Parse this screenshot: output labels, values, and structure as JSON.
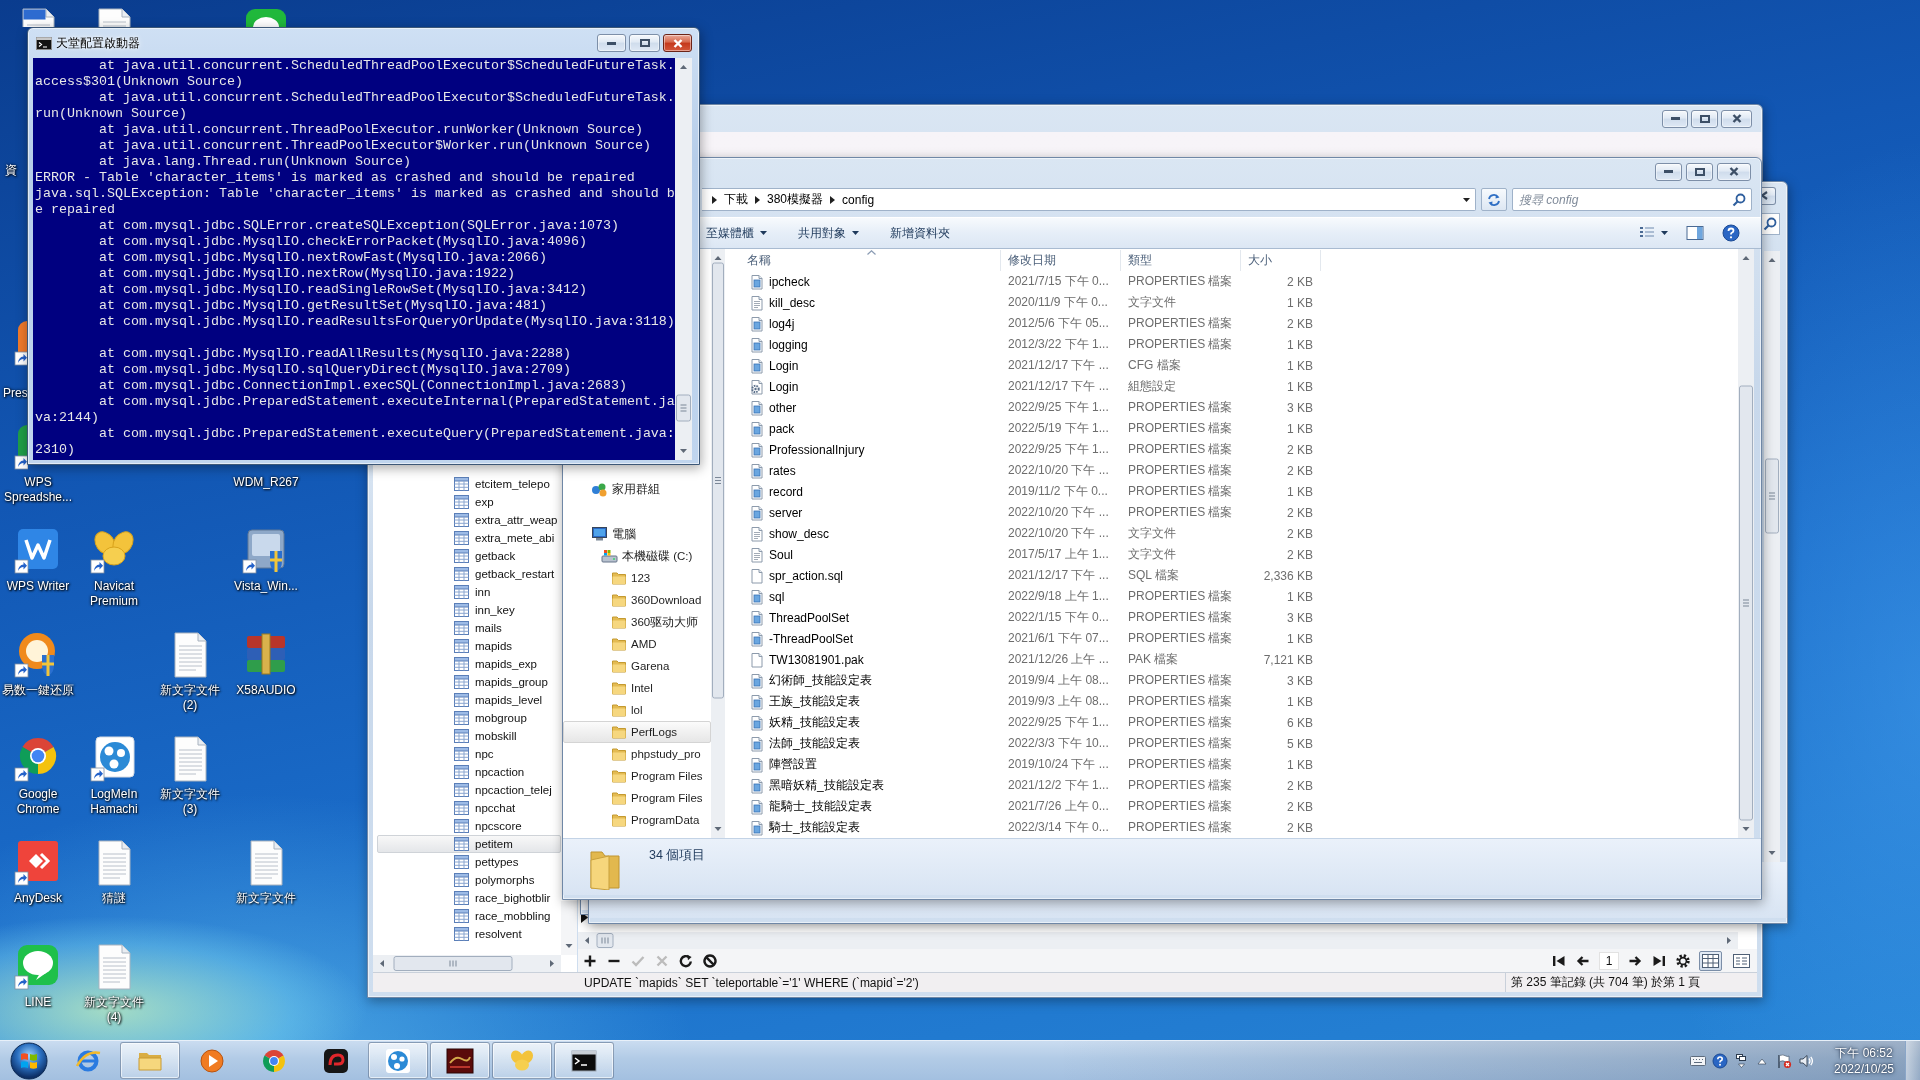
{
  "desktop": {
    "icons": [
      {
        "kind": "document"
      },
      {
        "kind": "text-file"
      },
      {
        "kind": "app"
      },
      {
        "kind": "label-only",
        "label": "資"
      },
      {
        "kind": "app",
        "label": "Pres"
      },
      {
        "kind": "app",
        "label": "WPS Spreadshe..."
      },
      {
        "kind": "label-only",
        "label": "WDM_R267"
      },
      {
        "kind": "app",
        "label": "WPS Writer"
      },
      {
        "kind": "app",
        "label": "Navicat Premium"
      },
      {
        "kind": "app",
        "label": "Vista_Win..."
      },
      {
        "kind": "app",
        "label": "易数一鍵还原"
      },
      {
        "kind": "text-file",
        "label": "新文字文件 (2)"
      },
      {
        "kind": "app",
        "label": "X58AUDIO"
      },
      {
        "kind": "app",
        "label": "Google Chrome"
      },
      {
        "kind": "app",
        "label": "LogMeIn Hamachi"
      },
      {
        "kind": "text-file",
        "label": "新文字文件 (3)"
      },
      {
        "kind": "app",
        "label": "AnyDesk"
      },
      {
        "kind": "text-file",
        "label": "猜謎"
      },
      {
        "kind": "text-file",
        "label": "新文字文件"
      },
      {
        "kind": "app",
        "label": "LINE"
      },
      {
        "kind": "text-file",
        "label": "新文字文件 (4)"
      }
    ]
  },
  "console": {
    "title": "天堂配置啟動器",
    "lines": [
      {
        "kind": "frame",
        "text": "at java.util.concurrent.ScheduledThreadPoolExecutor$ScheduledFutureTask."
      },
      {
        "kind": "message",
        "text": "access$301(Unknown Source)"
      },
      {
        "kind": "frame",
        "text": "at java.util.concurrent.ScheduledThreadPoolExecutor$ScheduledFutureTask."
      },
      {
        "kind": "message",
        "text": "run(Unknown Source)"
      },
      {
        "kind": "frame",
        "text": "at java.util.concurrent.ThreadPoolExecutor.runWorker(Unknown Source)"
      },
      {
        "kind": "frame",
        "text": "at java.util.concurrent.ThreadPoolExecutor$Worker.run(Unknown Source)"
      },
      {
        "kind": "frame",
        "text": "at java.lang.Thread.run(Unknown Source)"
      },
      {
        "kind": "message",
        "text": "ERROR - Table 'character_items' is marked as crashed and should be repaired"
      },
      {
        "kind": "message",
        "text": "java.sql.SQLException: Table 'character_items' is marked as crashed and should b"
      },
      {
        "kind": "message",
        "text": "e repaired"
      },
      {
        "kind": "frame",
        "text": "at com.mysql.jdbc.SQLError.createSQLException(SQLError.java:1073)"
      },
      {
        "kind": "frame",
        "text": "at com.mysql.jdbc.MysqlIO.checkErrorPacket(MysqlIO.java:4096)"
      },
      {
        "kind": "frame",
        "text": "at com.mysql.jdbc.MysqlIO.nextRowFast(MysqlIO.java:2066)"
      },
      {
        "kind": "frame",
        "text": "at com.mysql.jdbc.MysqlIO.nextRow(MysqlIO.java:1922)"
      },
      {
        "kind": "frame",
        "text": "at com.mysql.jdbc.MysqlIO.readSingleRowSet(MysqlIO.java:3412)"
      },
      {
        "kind": "frame",
        "text": "at com.mysql.jdbc.MysqlIO.getResultSet(MysqlIO.java:481)"
      },
      {
        "kind": "frame",
        "text": "at com.mysql.jdbc.MysqlIO.readResultsForQueryOrUpdate(MysqlIO.java:3118)"
      },
      {
        "kind": "blank"
      },
      {
        "kind": "frame",
        "text": "at com.mysql.jdbc.MysqlIO.readAllResults(MysqlIO.java:2288)"
      },
      {
        "kind": "frame",
        "text": "at com.mysql.jdbc.MysqlIO.sqlQueryDirect(MysqlIO.java:2709)"
      },
      {
        "kind": "frame",
        "text": "at com.mysql.jdbc.ConnectionImpl.execSQL(ConnectionImpl.java:2683)"
      },
      {
        "kind": "frame",
        "text": "at com.mysql.jdbc.PreparedStatement.executeInternal(PreparedStatement.ja"
      },
      {
        "kind": "message",
        "text": "va:2144)"
      },
      {
        "kind": "frame",
        "text": "at com.mysql.jdbc.PreparedStatement.executeQuery(PreparedStatement.java:"
      },
      {
        "kind": "message",
        "text": "2310)"
      }
    ]
  },
  "explorer": {
    "breadcrumb": [
      "下載",
      "380模擬器",
      "config"
    ],
    "search": {
      "placeholder": "搜尋 config"
    },
    "toolbar": [
      {
        "label": "至媒體櫃",
        "menu": true
      },
      {
        "label": "共用對象",
        "menu": true
      },
      {
        "label": "新增資料夾",
        "menu": false
      }
    ],
    "nav": [
      {
        "label": "家用群組",
        "kind": "homegroup",
        "selected": false
      },
      {
        "label": "電腦",
        "kind": "computer",
        "selected": false,
        "children": [
          {
            "label": "本機磁碟 (C:)",
            "kind": "drive",
            "selected": false,
            "children": [
              {
                "label": "123",
                "kind": "folder",
                "selected": false
              },
              {
                "label": "360Download",
                "kind": "folder",
                "selected": false
              },
              {
                "label": "360驱动大师",
                "kind": "folder",
                "selected": false
              },
              {
                "label": "AMD",
                "kind": "folder",
                "selected": false
              },
              {
                "label": "Garena",
                "kind": "folder",
                "selected": false
              },
              {
                "label": "Intel",
                "kind": "folder",
                "selected": false
              },
              {
                "label": "lol",
                "kind": "folder",
                "selected": false
              },
              {
                "label": "PerfLogs",
                "kind": "folder",
                "selected": true
              },
              {
                "label": "phpstudy_pro",
                "kind": "folder",
                "selected": false
              },
              {
                "label": "Program Files",
                "kind": "folder",
                "selected": false
              },
              {
                "label": "Program Files",
                "kind": "folder",
                "selected": false
              },
              {
                "label": "ProgramData",
                "kind": "folder",
                "selected": false
              }
            ]
          }
        ]
      }
    ],
    "columns": [
      {
        "label": "名稱",
        "sorted": true
      },
      {
        "label": "修改日期",
        "sorted": false
      },
      {
        "label": "類型",
        "sorted": false
      },
      {
        "label": "大小",
        "sorted": false
      }
    ],
    "files": [
      {
        "name": "ipcheck",
        "modified": "2021/7/15 下午 0...",
        "type": "PROPERTIES 檔案",
        "size": "2 KB",
        "kind": "properties"
      },
      {
        "name": "kill_desc",
        "modified": "2020/11/9 下午 0...",
        "type": "文字文件",
        "size": "1 KB",
        "kind": "text"
      },
      {
        "name": "log4j",
        "modified": "2012/5/6 下午 05...",
        "type": "PROPERTIES 檔案",
        "size": "2 KB",
        "kind": "properties"
      },
      {
        "name": "logging",
        "modified": "2012/3/22 下午 1...",
        "type": "PROPERTIES 檔案",
        "size": "1 KB",
        "kind": "properties"
      },
      {
        "name": "Login",
        "modified": "2021/12/17 下午 ...",
        "type": "CFG 檔案",
        "size": "1 KB",
        "kind": "properties"
      },
      {
        "name": "Login",
        "modified": "2021/12/17 下午 ...",
        "type": "組態設定",
        "size": "1 KB",
        "kind": "config"
      },
      {
        "name": "other",
        "modified": "2022/9/25 下午 1...",
        "type": "PROPERTIES 檔案",
        "size": "3 KB",
        "kind": "properties"
      },
      {
        "name": "pack",
        "modified": "2022/5/19 下午 1...",
        "type": "PROPERTIES 檔案",
        "size": "1 KB",
        "kind": "properties"
      },
      {
        "name": "ProfessionalInjury",
        "modified": "2022/9/25 下午 1...",
        "type": "PROPERTIES 檔案",
        "size": "2 KB",
        "kind": "properties"
      },
      {
        "name": "rates",
        "modified": "2022/10/20 下午 ...",
        "type": "PROPERTIES 檔案",
        "size": "2 KB",
        "kind": "properties"
      },
      {
        "name": "record",
        "modified": "2019/11/2 下午 0...",
        "type": "PROPERTIES 檔案",
        "size": "1 KB",
        "kind": "properties"
      },
      {
        "name": "server",
        "modified": "2022/10/20 下午 ...",
        "type": "PROPERTIES 檔案",
        "size": "2 KB",
        "kind": "properties"
      },
      {
        "name": "show_desc",
        "modified": "2022/10/20 下午 ...",
        "type": "文字文件",
        "size": "2 KB",
        "kind": "text"
      },
      {
        "name": "Soul",
        "modified": "2017/5/17 上午 1...",
        "type": "文字文件",
        "size": "2 KB",
        "kind": "text"
      },
      {
        "name": "spr_action.sql",
        "modified": "2021/12/17 下午 ...",
        "type": "SQL 檔案",
        "size": "2,336 KB",
        "kind": "blank"
      },
      {
        "name": "sql",
        "modified": "2022/9/18 上午 1...",
        "type": "PROPERTIES 檔案",
        "size": "1 KB",
        "kind": "properties"
      },
      {
        "name": "ThreadPoolSet",
        "modified": "2022/1/15 下午 0...",
        "type": "PROPERTIES 檔案",
        "size": "3 KB",
        "kind": "properties"
      },
      {
        "name": "-ThreadPoolSet",
        "modified": "2021/6/1 下午 07...",
        "type": "PROPERTIES 檔案",
        "size": "1 KB",
        "kind": "properties"
      },
      {
        "name": "TW13081901.pak",
        "modified": "2021/12/26 上午 ...",
        "type": "PAK 檔案",
        "size": "7,121 KB",
        "kind": "blank"
      },
      {
        "name": "幻術師_技能設定表",
        "modified": "2019/9/4 上午 08...",
        "type": "PROPERTIES 檔案",
        "size": "3 KB",
        "kind": "properties"
      },
      {
        "name": "王族_技能設定表",
        "modified": "2019/9/3 上午 08...",
        "type": "PROPERTIES 檔案",
        "size": "1 KB",
        "kind": "properties"
      },
      {
        "name": "妖精_技能設定表",
        "modified": "2022/9/25 下午 1...",
        "type": "PROPERTIES 檔案",
        "size": "6 KB",
        "kind": "properties"
      },
      {
        "name": "法師_技能設定表",
        "modified": "2022/3/3 下午 10...",
        "type": "PROPERTIES 檔案",
        "size": "5 KB",
        "kind": "properties"
      },
      {
        "name": "陣營設置",
        "modified": "2019/10/24 下午 ...",
        "type": "PROPERTIES 檔案",
        "size": "1 KB",
        "kind": "properties"
      },
      {
        "name": "黑暗妖精_技能設定表",
        "modified": "2021/12/2 下午 1...",
        "type": "PROPERTIES 檔案",
        "size": "2 KB",
        "kind": "properties"
      },
      {
        "name": "龍騎士_技能設定表",
        "modified": "2021/7/26 上午 0...",
        "type": "PROPERTIES 檔案",
        "size": "2 KB",
        "kind": "properties"
      },
      {
        "name": "騎士_技能設定表",
        "modified": "2022/3/14 下午 0...",
        "type": "PROPERTIES 檔案",
        "size": "2 KB",
        "kind": "properties"
      }
    ],
    "details": {
      "count": "34 個項目"
    }
  },
  "navicat": {
    "tables": [
      {
        "label": "etcitem_telepo",
        "selected": false
      },
      {
        "label": "exp",
        "selected": false
      },
      {
        "label": "extra_attr_weap",
        "selected": false
      },
      {
        "label": "extra_mete_abi",
        "selected": false
      },
      {
        "label": "getback",
        "selected": false
      },
      {
        "label": "getback_restart",
        "selected": false
      },
      {
        "label": "inn",
        "selected": false
      },
      {
        "label": "inn_key",
        "selected": false
      },
      {
        "label": "mails",
        "selected": false
      },
      {
        "label": "mapids",
        "selected": false
      },
      {
        "label": "mapids_exp",
        "selected": false
      },
      {
        "label": "mapids_group",
        "selected": false
      },
      {
        "label": "mapids_level",
        "selected": false
      },
      {
        "label": "mobgroup",
        "selected": false
      },
      {
        "label": "mobskill",
        "selected": false
      },
      {
        "label": "npc",
        "selected": false
      },
      {
        "label": "npcaction",
        "selected": false
      },
      {
        "label": "npcaction_telej",
        "selected": false
      },
      {
        "label": "npcchat",
        "selected": false
      },
      {
        "label": "npcscore",
        "selected": false
      },
      {
        "label": "petitem",
        "selected": true
      },
      {
        "label": "pettypes",
        "selected": false
      },
      {
        "label": "polymorphs",
        "selected": false
      },
      {
        "label": "race_bighotblir",
        "selected": false
      },
      {
        "label": "race_mobbling",
        "selected": false
      },
      {
        "label": "resolvent",
        "selected": false
      }
    ],
    "record_buttons": [
      {
        "disabled": false
      },
      {
        "disabled": false
      },
      {
        "disabled": true
      },
      {
        "disabled": true
      },
      {
        "disabled": false
      },
      {
        "disabled": false
      }
    ],
    "page": "1",
    "view_buttons": [
      {
        "selected": true
      },
      {
        "selected": false
      }
    ],
    "status": {
      "sql": "UPDATE `mapids` SET `teleportable`='1' WHERE (`mapid`='2')",
      "records": "第 235 筆記錄 (共 704 筆) 於第 1 頁"
    }
  },
  "taskbar": {
    "apps": [
      {
        "open": false
      },
      {
        "open": true
      },
      {
        "open": false
      },
      {
        "open": false
      },
      {
        "open": false
      },
      {
        "open": true
      },
      {
        "open": true
      },
      {
        "open": true
      },
      {
        "open": true
      }
    ],
    "clock": {
      "time": "下午 06:52",
      "date": "2022/10/25"
    }
  }
}
